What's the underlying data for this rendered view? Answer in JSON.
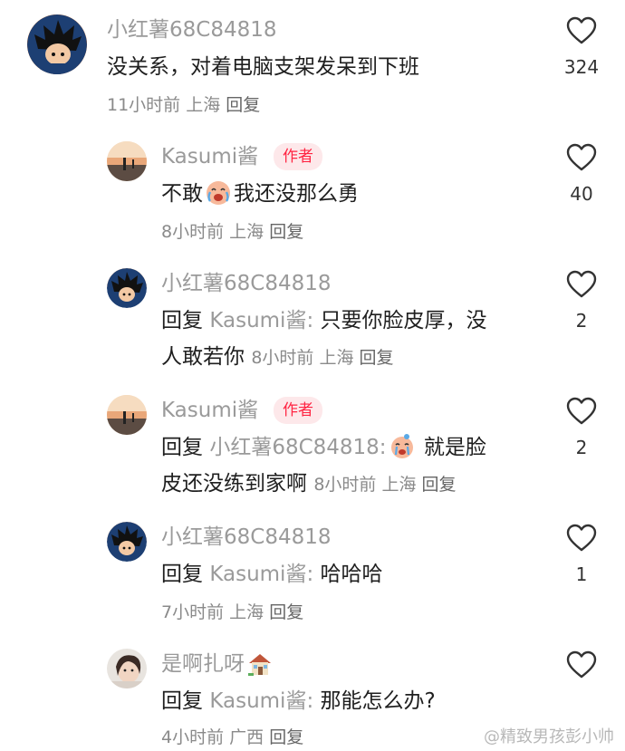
{
  "comments": [
    {
      "author": "小红薯68C84818",
      "text": "没关系，对着电脑支架发呆到下班",
      "time": "11小时前",
      "location": "上海",
      "reply_label": "回复",
      "likes": "324",
      "avatar": "goku-avatar"
    },
    {
      "author": "Kasumi酱",
      "author_tag": "作者",
      "text_before": "不敢",
      "text_after": "我还没那么勇",
      "emoji": "crying-laughing-face-emoji",
      "time": "8小时前",
      "location": "上海",
      "reply_label": "回复",
      "likes": "40",
      "avatar": "sunset-avatar"
    },
    {
      "author": "小红薯68C84818",
      "reply_prefix": "回复",
      "reply_to": "Kasumi酱:",
      "text_line1": "只要你脸皮厚，没",
      "text_line2": "人敢若你",
      "time": "8小时前",
      "location": "上海",
      "reply_label": "回复",
      "likes": "2",
      "avatar": "goku-avatar"
    },
    {
      "author": "Kasumi酱",
      "author_tag": "作者",
      "reply_prefix": "回复",
      "reply_to": "小红薯68C84818:",
      "text_line1": "就是脸",
      "text_line2": "皮还没练到家啊",
      "emoji": "crying-face-emoji",
      "time": "8小时前",
      "location": "上海",
      "reply_label": "回复",
      "likes": "2",
      "avatar": "sunset-avatar"
    },
    {
      "author": "小红薯68C84818",
      "reply_prefix": "回复",
      "reply_to": "Kasumi酱:",
      "text": "哈哈哈",
      "time": "7小时前",
      "location": "上海",
      "reply_label": "回复",
      "likes": "1",
      "avatar": "goku-avatar"
    },
    {
      "author": "是啊扎呀",
      "author_emoji": "house-icon",
      "reply_prefix": "回复",
      "reply_to": "Kasumi酱:",
      "text": "那能怎么办?",
      "time": "4小时前",
      "location": "广西",
      "reply_label": "回复",
      "likes": "",
      "avatar": "girl-avatar"
    }
  ],
  "watermark": "@精致男孩彭小帅",
  "colors": {
    "author_tag": "#ff2442",
    "name_gray": "#9a9a9a"
  }
}
